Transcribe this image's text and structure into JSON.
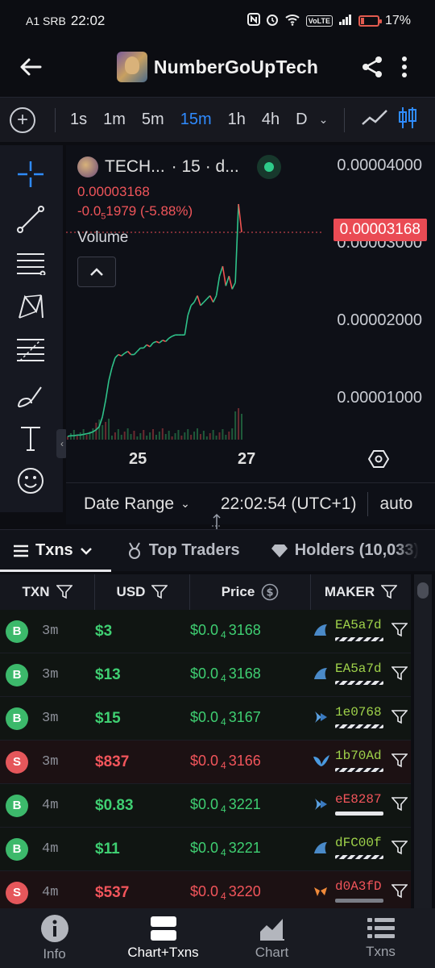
{
  "status_bar": {
    "carrier": "A1 SRB",
    "time": "22:02",
    "volte": "VoLTE",
    "battery": "17%"
  },
  "header": {
    "title": "NumberGoUpTech"
  },
  "timeframes": {
    "items": [
      "1s",
      "1m",
      "5m",
      "15m",
      "1h",
      "4h",
      "D"
    ],
    "active": "15m"
  },
  "chart": {
    "symbol": "TECH...",
    "interval": "· 15 · d...",
    "price": "0.00003168",
    "change_prefix": "-0.0",
    "change_sub": "5",
    "change_rest": "1979 (-5.88%)",
    "volume_label": "Volume",
    "price_tag": "0.00003168",
    "footer": {
      "date_range": "Date Range",
      "timestamp": "22:02:54 (UTC+1)",
      "scale": "auto"
    }
  },
  "chart_data": {
    "type": "line",
    "title": "TECH... · 15",
    "x_ticks": [
      "25",
      "27"
    ],
    "y_ticks": [
      "0.00004000",
      "0.00003000",
      "0.00002000",
      "0.00001000"
    ],
    "ylim": [
      0,
      4.5e-05
    ],
    "last_price": 3.168e-05,
    "series": [
      {
        "values": [
          5e-07,
          6e-07,
          6e-07,
          7e-07,
          7e-07,
          8e-07,
          9e-07,
          1e-06,
          1.2e-06,
          1.5e-06,
          2e-06,
          3.5e-06,
          6e-06,
          9e-06,
          1.1e-05,
          1.25e-05,
          1.3e-05,
          1.28e-05,
          1.32e-05,
          1.35e-05,
          1.3e-05,
          1.3e-05,
          1.35e-05,
          1.4e-05,
          1.4e-05,
          1.45e-05,
          1.42e-05,
          1.48e-05,
          1.5e-05,
          1.48e-05,
          1.52e-05,
          1.5e-05,
          1.55e-05,
          1.58e-05,
          1.6e-05,
          1.6e-05,
          1.6e-05,
          1.6e-05,
          1.9e-05,
          2.05e-05,
          2.1e-05,
          2.2e-05,
          2.05e-05,
          2.1e-05,
          2.15e-05,
          2.2e-05,
          2.1e-05,
          2.2e-05,
          2.5e-05,
          2.65e-05,
          2.35e-05,
          2.5e-05,
          2.3e-05,
          2.4e-05,
          3.6e-05,
          3.17e-05
        ]
      }
    ]
  },
  "tabs": [
    {
      "label": "Txns",
      "active": true
    },
    {
      "label": "Top Traders",
      "active": false
    },
    {
      "label": "Holders (10,033)",
      "active": false
    }
  ],
  "table": {
    "headers": [
      "TXN",
      "USD",
      "Price",
      "MAKER"
    ],
    "price_prefix": "$0.0",
    "price_sub": "4",
    "rows": [
      {
        "type": "B",
        "age": "3m",
        "usd": "$3",
        "price": "3168",
        "maker": "EA5a7d",
        "side": "b"
      },
      {
        "type": "B",
        "age": "3m",
        "usd": "$13",
        "price": "3168",
        "maker": "EA5a7d",
        "side": "b"
      },
      {
        "type": "B",
        "age": "3m",
        "usd": "$15",
        "price": "3167",
        "maker": "1e0768",
        "side": "b"
      },
      {
        "type": "S",
        "age": "3m",
        "usd": "$837",
        "price": "3166",
        "maker": "1b70Ad",
        "side": "s"
      },
      {
        "type": "B",
        "age": "4m",
        "usd": "$0.83",
        "price": "3221",
        "maker": "eE8287",
        "side": "b"
      },
      {
        "type": "B",
        "age": "4m",
        "usd": "$11",
        "price": "3221",
        "maker": "dFC00f",
        "side": "b"
      },
      {
        "type": "S",
        "age": "4m",
        "usd": "$537",
        "price": "3220",
        "maker": "d0A3fD",
        "side": "s"
      }
    ]
  },
  "bottom_nav": [
    {
      "label": "Info",
      "icon": "info-icon",
      "active": false
    },
    {
      "label": "Chart+Txns",
      "icon": "chart-txns-icon",
      "active": true
    },
    {
      "label": "Chart",
      "icon": "area-chart-icon",
      "active": false
    },
    {
      "label": "Txns",
      "icon": "list-icon",
      "active": false
    }
  ],
  "colors": {
    "accent": "#2f8bff",
    "buy": "#3fcf72",
    "sell": "#f2555b"
  }
}
